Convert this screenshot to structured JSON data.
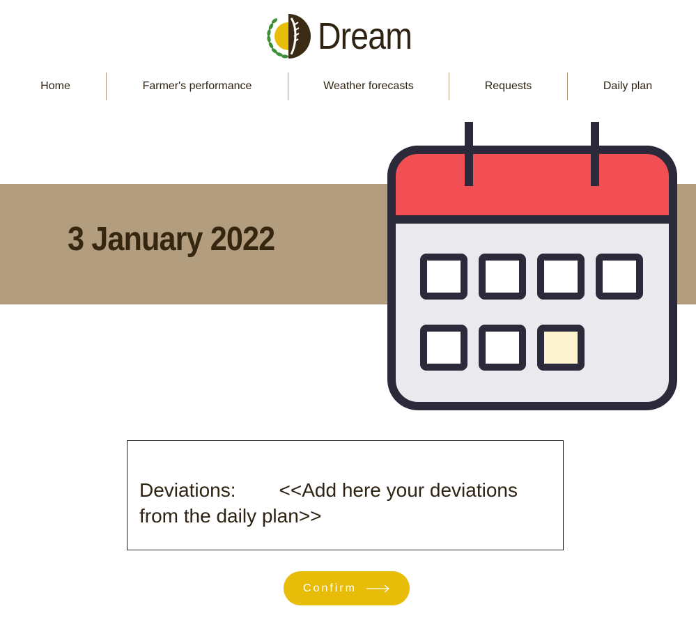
{
  "header": {
    "logo_icon": "wheat-sun-logo-icon",
    "brand_name": "Dream"
  },
  "nav": {
    "items": [
      {
        "label": "Home"
      },
      {
        "label": "Farmer's performance"
      },
      {
        "label": "Weather forecasts"
      },
      {
        "label": "Requests"
      },
      {
        "label": "Daily plan"
      }
    ]
  },
  "banner": {
    "date": "3 January 2022"
  },
  "illustration": {
    "icon": "calendar-icon",
    "colors": {
      "header": "#f24f55",
      "body": "#e9e9ee",
      "outline": "#2b2a3a",
      "highlight": "#fdf3d1"
    }
  },
  "deviations": {
    "label": "Deviations",
    "separator": ":",
    "placeholder": "<<Add here your deviations from the daily plan>>"
  },
  "confirm": {
    "label": "Confirm",
    "icon": "arrow-right-icon"
  },
  "colors": {
    "banner": "#b39d7f",
    "accent": "#e8bd0a",
    "text": "#2e2212"
  }
}
